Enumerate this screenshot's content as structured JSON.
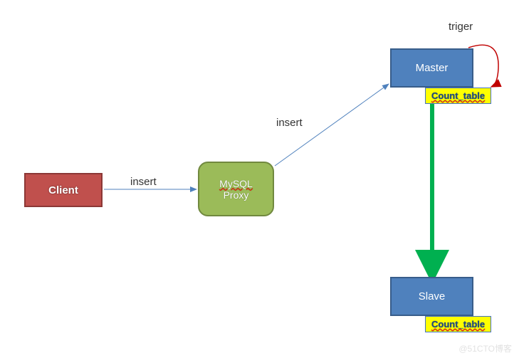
{
  "nodes": {
    "client": "Client",
    "proxy_line1": "MySQL",
    "proxy_line2": "Proxy",
    "master": "Master",
    "slave": "Slave",
    "count_table_1": "Count_table",
    "count_table_2": "Count_table"
  },
  "labels": {
    "edge_client_proxy": "insert",
    "edge_proxy_master": "insert",
    "trigger": "triger"
  },
  "watermark": "@51CTO博客",
  "chart_data": {
    "type": "diagram",
    "nodes": [
      {
        "id": "client",
        "label": "Client",
        "color": "#c0504d"
      },
      {
        "id": "proxy",
        "label": "MySQL Proxy",
        "color": "#9bbb59"
      },
      {
        "id": "master",
        "label": "Master",
        "color": "#4f81bd"
      },
      {
        "id": "slave",
        "label": "Slave",
        "color": "#4f81bd"
      },
      {
        "id": "count_table_master",
        "label": "Count_table",
        "color": "#ffff00"
      },
      {
        "id": "count_table_slave",
        "label": "Count_table",
        "color": "#ffff00"
      }
    ],
    "edges": [
      {
        "from": "client",
        "to": "proxy",
        "label": "insert",
        "style": "thin-arrow"
      },
      {
        "from": "proxy",
        "to": "master",
        "label": "insert",
        "style": "thin-arrow"
      },
      {
        "from": "master",
        "to": "count_table_master",
        "label": "triger",
        "style": "curved-red"
      },
      {
        "from": "master",
        "to": "slave",
        "label": "",
        "style": "thick-green"
      }
    ]
  }
}
